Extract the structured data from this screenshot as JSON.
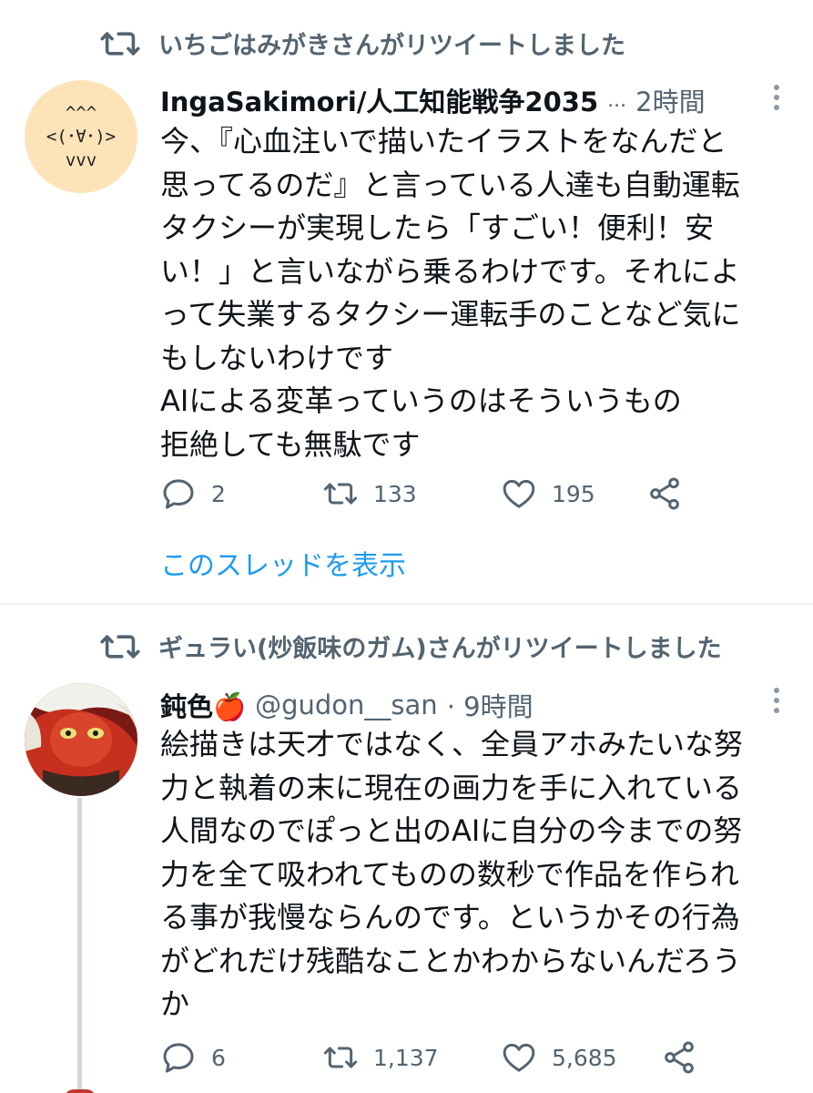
{
  "tweets": [
    {
      "retweeted_by": "いちごはみがきさんがリツイートしました",
      "avatar_text": [
        "^^^",
        "<(･∀･)>",
        "vvv"
      ],
      "name": "IngaSakimori/人工知能戦争2035",
      "handle_ellipsis": "...",
      "time": "2時間",
      "text": "今、『心血注いで描いたイラストをなんだと\n思ってるのだ』と言っている人達も自動運転\nタクシーが実現したら「すごい！便利！安\nい！」と言いながら乗るわけです。それによ\nって失業するタクシー運転手のことなど気に\nもしないわけです\nAIによる変革っていうのはそういうもの\n拒絶しても無駄です",
      "replies": "2",
      "retweets": "133",
      "likes": "195",
      "show_thread": "このスレッドを表示"
    },
    {
      "retweeted_by": "ギュラい(炒飯味のガム)さんがリツイートしました",
      "name": "鈍色🍎",
      "handle": "@gudon__san",
      "time": "· 9時間",
      "text": "絵描きは天才ではなく、全員アホみたいな努\n力と執着の末に現在の画力を手に入れている\n人間なのでぽっと出のAIに自分の今までの努\n力を全て吸われてものの数秒で作品を作られ\nる事が我慢ならんのです。というかその行為\nがどれだけ残酷なことかわからないんだろう\nか",
      "replies": "6",
      "retweets": "1,137",
      "likes": "5,685"
    }
  ],
  "colors": {
    "text": "#0f1419",
    "secondary": "#536471",
    "link": "#1d9bf0",
    "divider": "#eff3f4",
    "avatar1_bg": "#fde3b8"
  },
  "icons": [
    "retweet-icon",
    "more-icon",
    "reply-icon",
    "like-icon",
    "share-icon"
  ]
}
